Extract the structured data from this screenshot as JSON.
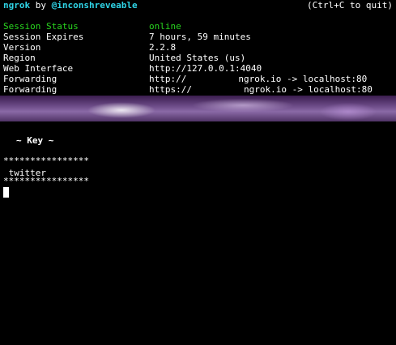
{
  "header": {
    "app_name": "ngrok",
    "by_text": "by",
    "author": "@inconshreveable",
    "quit_hint": "(Ctrl+C to quit)"
  },
  "status": [
    {
      "label": "Session Status",
      "value": "online"
    },
    {
      "label": "Session Expires",
      "value": "7 hours, 59 minutes"
    },
    {
      "label": "Version",
      "value": "2.2.8"
    },
    {
      "label": "Region",
      "value": "United States (us)"
    },
    {
      "label": "Web Interface",
      "value": "http://127.0.0.1:4040"
    },
    {
      "label": "Forwarding",
      "value_prefix": "http://",
      "value_suffix": "ngrok.io -> localhost:80"
    },
    {
      "label": "Forwarding",
      "value_prefix": "https://",
      "value_suffix": "ngrok.io -> localhost:80"
    }
  ],
  "colors": {
    "brand": "#2fd4e6",
    "online": "#29d61f",
    "text": "#ffffff",
    "background": "#000000"
  },
  "bottom": {
    "title": "~ Key ~",
    "separator_top": "****************",
    "entry": " twitter",
    "separator_bottom": "****************"
  }
}
